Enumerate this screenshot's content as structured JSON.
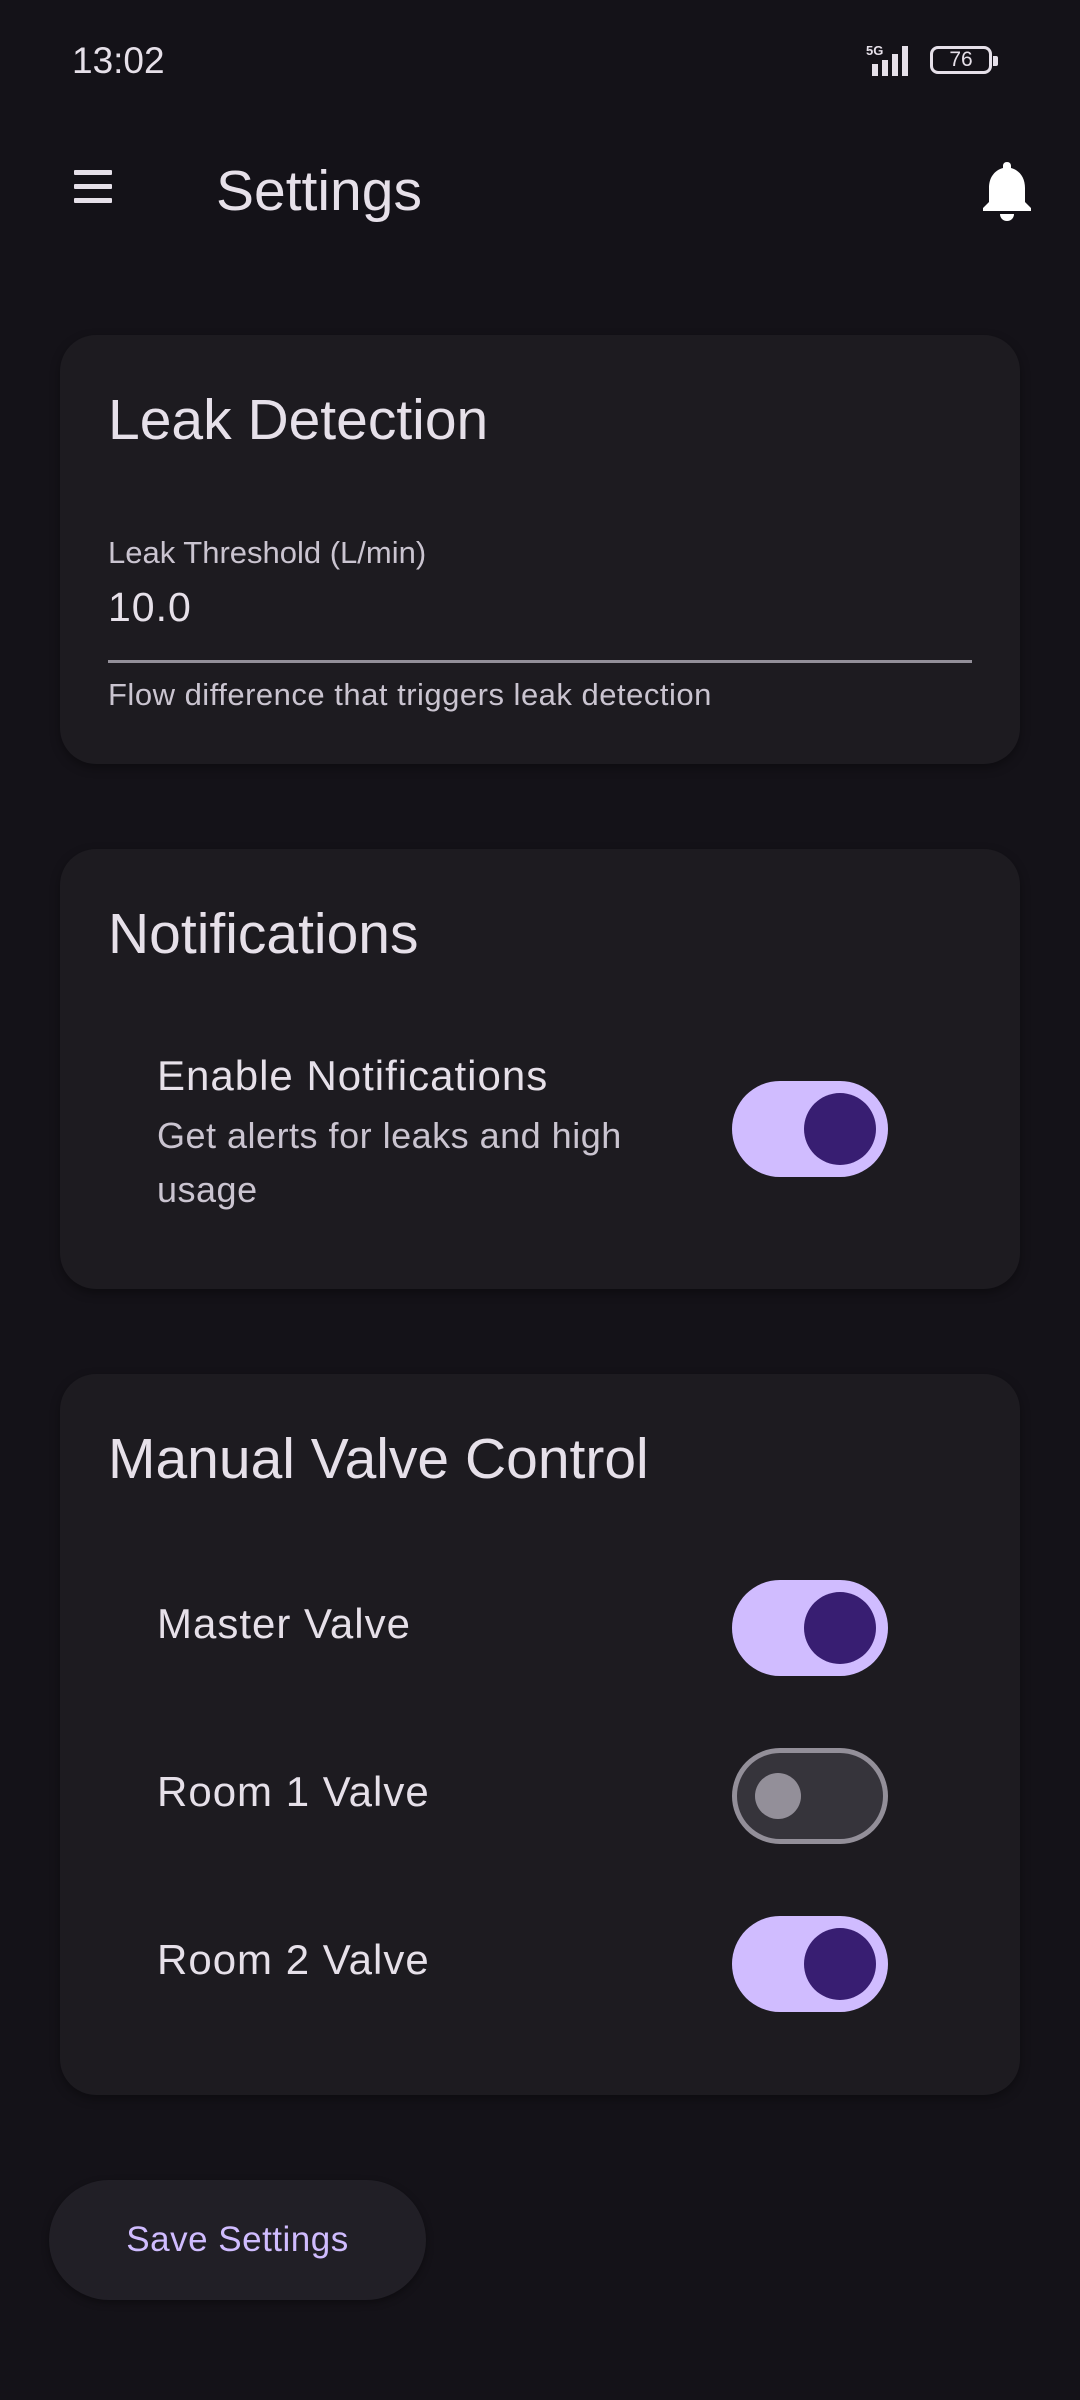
{
  "status_bar": {
    "time": "13:02",
    "network": "5G",
    "battery": "76"
  },
  "app_bar": {
    "title": "Settings",
    "menu_icon": "menu-icon",
    "bell_icon": "bell-icon"
  },
  "leak_card": {
    "title": "Leak Detection",
    "field_label": "Leak Threshold (L/min)",
    "field_value": "10.0",
    "helper": "Flow difference that triggers leak detection"
  },
  "notifications_card": {
    "title": "Notifications",
    "toggle_label": "Enable Notifications",
    "toggle_sub": "Get alerts for leaks and high usage",
    "enabled": true
  },
  "valves_card": {
    "title": "Manual Valve Control",
    "valves": [
      {
        "label": "Master Valve",
        "on": true
      },
      {
        "label": "Room 1 Valve",
        "on": false
      },
      {
        "label": "Room 2 Valve",
        "on": true
      }
    ]
  },
  "save_button": {
    "label": "Save Settings"
  },
  "colors": {
    "background": "#141218",
    "card": "#1d1b20",
    "accent": "#d0bcff",
    "thumb_on": "#381e72"
  }
}
